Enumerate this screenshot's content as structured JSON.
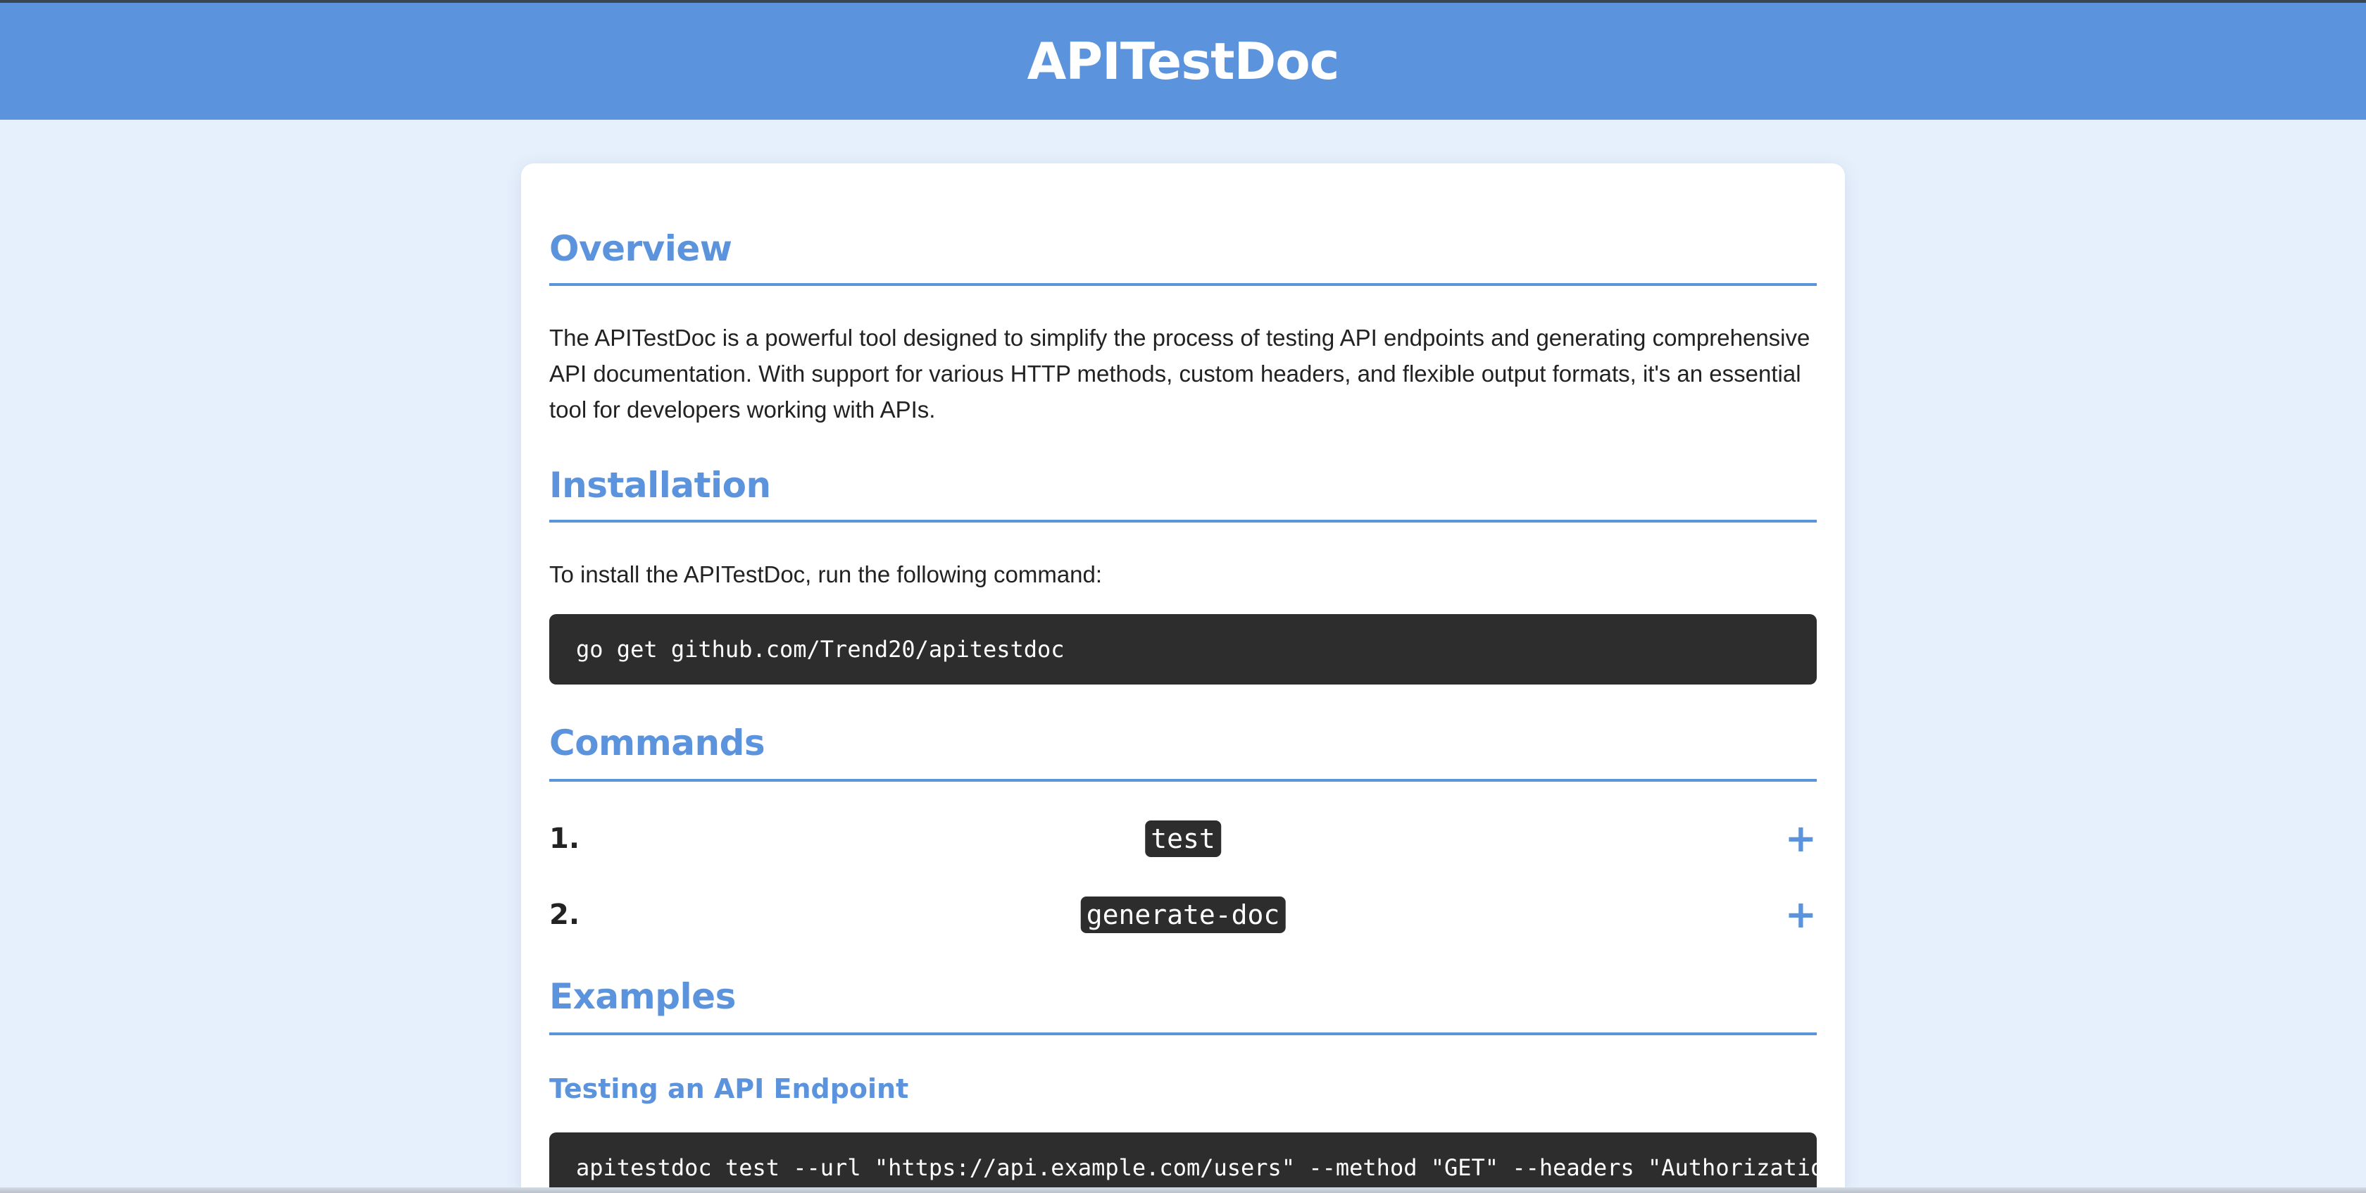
{
  "header": {
    "title": "APITestDoc"
  },
  "overview": {
    "title": "Overview",
    "text": "The APITestDoc is a powerful tool designed to simplify the process of testing API endpoints and generating comprehensive API documentation. With support for various HTTP methods, custom headers, and flexible output formats, it's an essential tool for developers working with APIs."
  },
  "installation": {
    "title": "Installation",
    "text": "To install the APITestDoc, run the following command:",
    "code": "go get github.com/Trend20/apitestdoc"
  },
  "commands": {
    "title": "Commands",
    "items": [
      {
        "number": "1.",
        "name": "test",
        "toggle": "+"
      },
      {
        "number": "2.",
        "name": "generate-doc",
        "toggle": "+"
      }
    ]
  },
  "examples": {
    "title": "Examples",
    "subtitle": "Testing an API Endpoint",
    "code": "apitestdoc test --url \"https://api.example.com/users\" --method \"GET\" --headers \"Authorization:Bea"
  },
  "colors": {
    "accent": "#5b93dd",
    "background": "#e6f0fc",
    "code_bg": "#2d2d2d"
  }
}
